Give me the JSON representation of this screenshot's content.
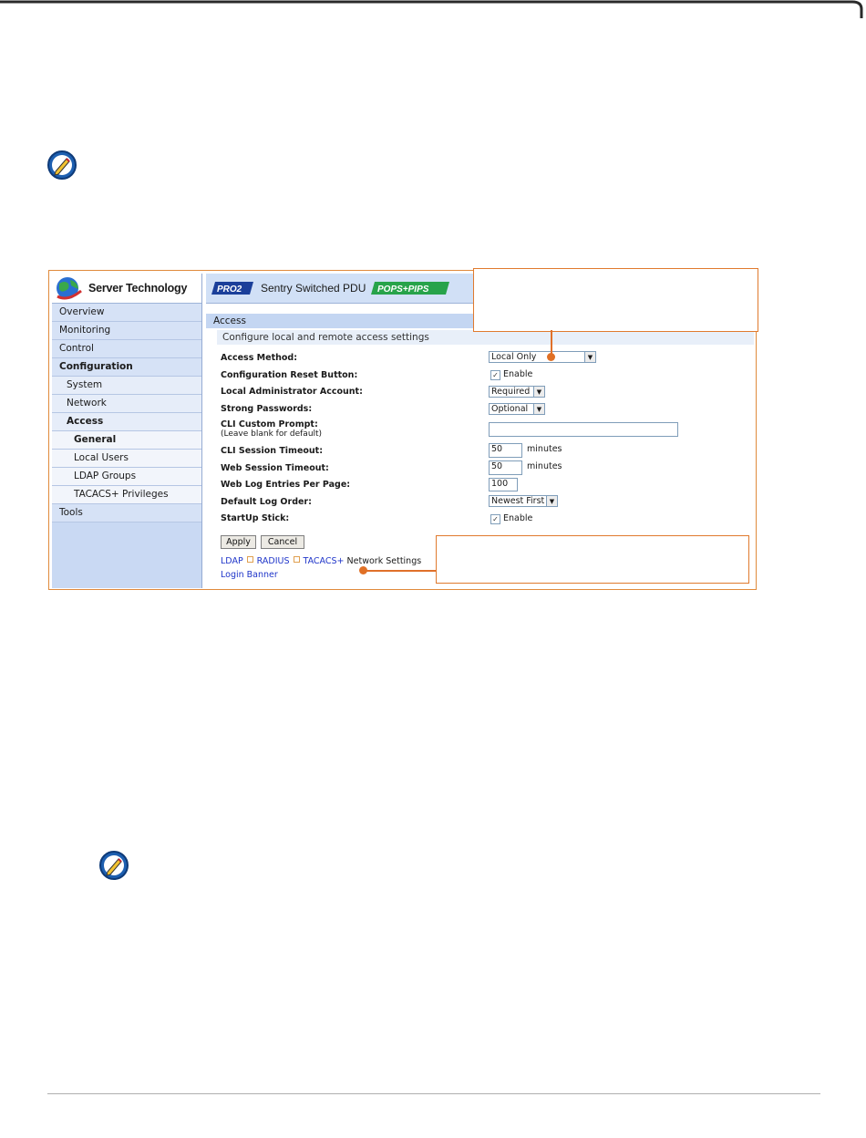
{
  "sidebar": {
    "brand": "Server Technology",
    "items": [
      {
        "label": "Overview",
        "level": 0,
        "bold": false
      },
      {
        "label": "Monitoring",
        "level": 0,
        "bold": false
      },
      {
        "label": "Control",
        "level": 0,
        "bold": false
      },
      {
        "label": "Configuration",
        "level": 0,
        "bold": true
      },
      {
        "label": "System",
        "level": 1,
        "bold": false
      },
      {
        "label": "Network",
        "level": 1,
        "bold": false
      },
      {
        "label": "Access",
        "level": 1,
        "bold": true
      },
      {
        "label": "General",
        "level": 2,
        "bold": true
      },
      {
        "label": "Local Users",
        "level": 2,
        "bold": false
      },
      {
        "label": "LDAP Groups",
        "level": 2,
        "bold": false
      },
      {
        "label": "TACACS+ Privileges",
        "level": 2,
        "bold": false
      },
      {
        "label": "Tools",
        "level": 0,
        "bold": false
      }
    ]
  },
  "header": {
    "pro_badge": "PRO2",
    "title": "Sentry Switched PDU",
    "pops_badge": "POPS+PIPS"
  },
  "section": {
    "title": "Access",
    "subtitle": "Configure local and remote access settings"
  },
  "form": {
    "access_method": {
      "label": "Access Method:",
      "value": "Local Only"
    },
    "config_reset": {
      "label": "Configuration Reset Button:",
      "checkbox_label": "Enable",
      "checked": true
    },
    "local_admin": {
      "label": "Local Administrator Account:",
      "value": "Required"
    },
    "strong_passwords": {
      "label": "Strong Passwords:",
      "value": "Optional"
    },
    "cli_prompt": {
      "label": "CLI Custom Prompt:",
      "hint": "(Leave blank for default)",
      "value": ""
    },
    "cli_timeout": {
      "label": "CLI Session Timeout:",
      "value": "50",
      "unit": "minutes"
    },
    "web_timeout": {
      "label": "Web Session Timeout:",
      "value": "50",
      "unit": "minutes"
    },
    "web_log_entries": {
      "label": "Web Log Entries Per Page:",
      "value": "100"
    },
    "log_order": {
      "label": "Default Log Order:",
      "value": "Newest First"
    },
    "startup_stick": {
      "label": "StartUp Stick:",
      "checkbox_label": "Enable",
      "checked": true
    }
  },
  "buttons": {
    "apply": "Apply",
    "cancel": "Cancel"
  },
  "links": {
    "ldap": "LDAP",
    "radius": "RADIUS",
    "tacacs": "TACACS+",
    "network_settings": "Network Settings",
    "login_banner": "Login Banner"
  },
  "colors": {
    "callout": "#e07a2e",
    "sidebar": "#c9d9f3",
    "link": "#1f35c9"
  },
  "icons": [
    "note-pencil-icon",
    "globe-logo-icon",
    "dropdown-arrow-icon",
    "checkbox-icon"
  ]
}
